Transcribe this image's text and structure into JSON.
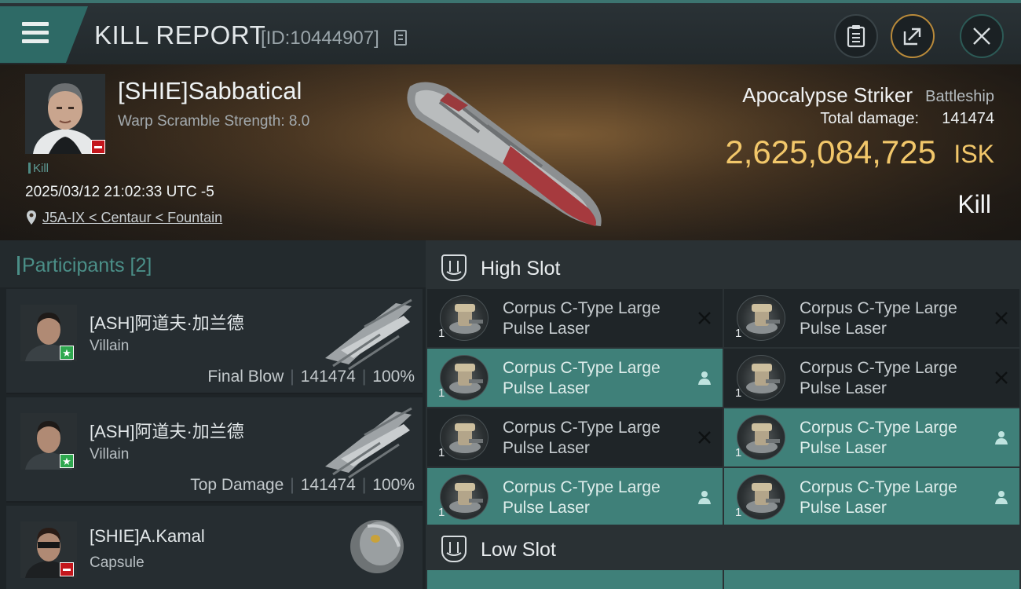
{
  "header": {
    "title": "KILL REPORT",
    "report_id": "[ID:10444907]"
  },
  "victim": {
    "name": "[SHIE]Sabbatical",
    "warp_scramble": "Warp Scramble Strength: 8.0",
    "tag": "Kill",
    "datetime": "2025/03/12 21:02:33 UTC -5",
    "location": "J5A-IX < Centaur < Fountain",
    "ship_name": "Apocalypse Striker",
    "ship_class": "Battleship",
    "total_damage_label": "Total damage:",
    "total_damage": "141474",
    "isk_value": "2,625,084,725",
    "isk_unit": "ISK",
    "result": "Kill"
  },
  "participants": {
    "title": "Participants [2]",
    "items": [
      {
        "name": "[ASH]阿道夫·加兰德",
        "ship": "Villain",
        "role": "Final Blow",
        "damage": "141474",
        "percent": "100%"
      },
      {
        "name": "[ASH]阿道夫·加兰德",
        "ship": "Villain",
        "role": "Top Damage",
        "damage": "141474",
        "percent": "100%"
      },
      {
        "name": "[SHIE]A.Kamal",
        "ship": "Capsule"
      }
    ]
  },
  "slots": {
    "high": {
      "title": "High Slot",
      "modules": [
        {
          "name": "Corpus C-Type Large Pulse Laser",
          "qty": "1",
          "status": "destroyed"
        },
        {
          "name": "Corpus C-Type Large Pulse Laser",
          "qty": "1",
          "status": "destroyed"
        },
        {
          "name": "Corpus C-Type Large Pulse Laser",
          "qty": "1",
          "status": "dropped"
        },
        {
          "name": "Corpus C-Type Large Pulse Laser",
          "qty": "1",
          "status": "destroyed"
        },
        {
          "name": "Corpus C-Type Large Pulse Laser",
          "qty": "1",
          "status": "destroyed"
        },
        {
          "name": "Corpus C-Type Large Pulse Laser",
          "qty": "1",
          "status": "dropped"
        },
        {
          "name": "Corpus C-Type Large Pulse Laser",
          "qty": "1",
          "status": "dropped"
        },
        {
          "name": "Corpus C-Type Large Pulse Laser",
          "qty": "1",
          "status": "dropped"
        }
      ]
    },
    "low": {
      "title": "Low Slot"
    }
  },
  "colors": {
    "accent": "#3f8079",
    "isk": "#f2c76a",
    "hostile_badge": "#c4161c",
    "friendly_badge": "#2fa84f"
  }
}
